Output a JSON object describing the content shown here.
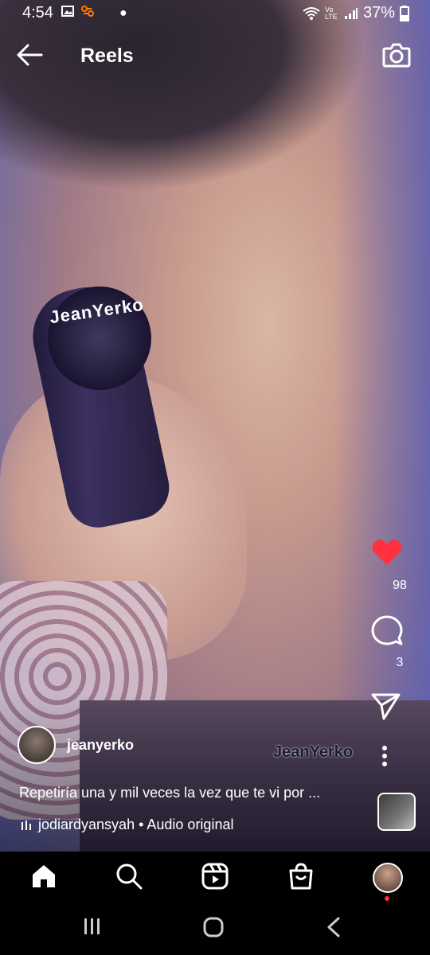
{
  "status_bar": {
    "time": "4:54",
    "network": "Vo LTE",
    "battery": "37%"
  },
  "top_bar": {
    "title": "Reels"
  },
  "video": {
    "overlay_mic_text": "JeanYerko",
    "watermark": "JeanYerko"
  },
  "actions": {
    "likes": "98",
    "comments": "3",
    "like_color": "#ff3040"
  },
  "post": {
    "username": "jeanyerko",
    "caption": "Repetiría una y mil veces la vez que te vi por ...",
    "audio": "jodiardyansyah • Audio original"
  },
  "icons": {
    "status": [
      "image-icon",
      "app-icon",
      "wifi-icon",
      "signal-icon",
      "battery-icon"
    ],
    "nav": [
      "home-icon",
      "search-icon",
      "reels-icon",
      "shop-icon",
      "profile-icon"
    ],
    "system": [
      "recent-apps-icon",
      "home-circle-icon",
      "back-chevron-icon"
    ]
  }
}
